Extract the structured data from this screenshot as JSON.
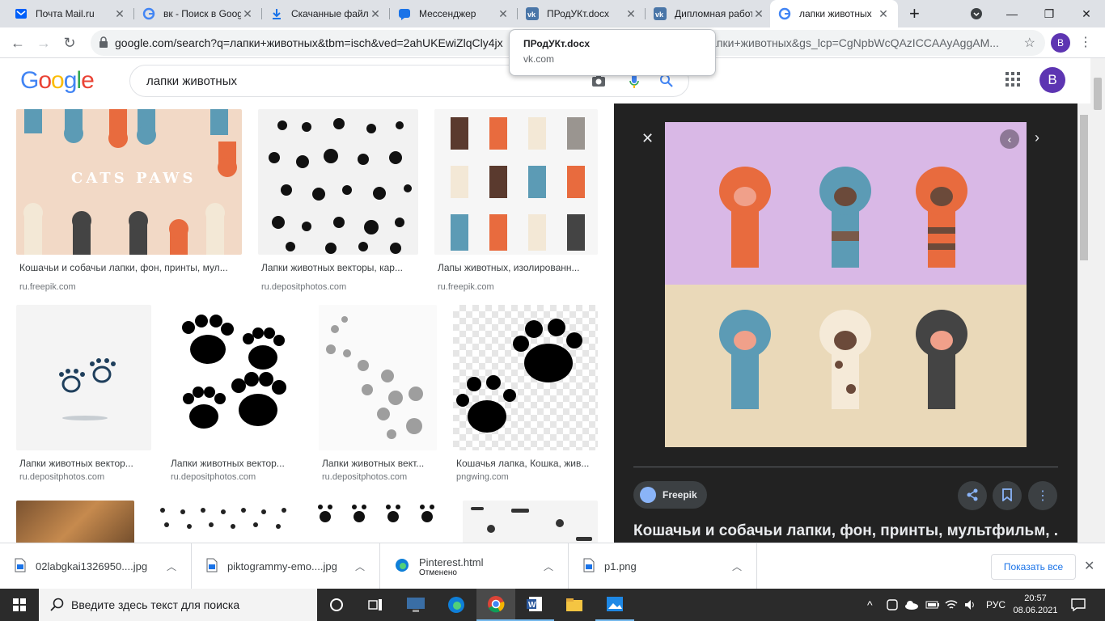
{
  "tabs": [
    {
      "label": "Почта Mail.ru",
      "icon": "mail-icon"
    },
    {
      "label": "вк - Поиск в Google",
      "icon": "google-icon"
    },
    {
      "label": "Скачанные файлы",
      "icon": "download-icon"
    },
    {
      "label": "Мессенджер",
      "icon": "messenger-icon"
    },
    {
      "label": "ПРодУКт.docx",
      "icon": "vk-icon"
    },
    {
      "label": "Дипломная работа",
      "icon": "vk-icon"
    },
    {
      "label": "лапки животных",
      "icon": "google-icon"
    }
  ],
  "toolbar": {
    "url": "google.com/search?q=лапки+животных&tbm=isch&ved=2ahUKEwiZlqCly4jx",
    "url_tail": "лапки+животных&gs_lcp=CgNpbWcQAzICCAAyAggAM...",
    "profile": "B"
  },
  "tooltip": {
    "title": "ПРодУКт.docx",
    "host": "vk.com"
  },
  "google": {
    "logo": "Google",
    "query": "лапки животных",
    "avatar": "B"
  },
  "results": [
    {
      "title": "Кошачьи и собачьи лапки, фон, принты, мул...",
      "source": "ru.freepik.com",
      "overlay": "CATS PAWS"
    },
    {
      "title": "Лапки животных векторы, кар...",
      "source": "ru.depositphotos.com"
    },
    {
      "title": "Лапы животных, изолированн...",
      "source": "ru.freepik.com"
    },
    {
      "title": "Лапки животных вектор...",
      "source": "ru.depositphotos.com"
    },
    {
      "title": "Лапки животных вектор...",
      "source": "ru.depositphotos.com"
    },
    {
      "title": "Лапки животных вект...",
      "source": "ru.depositphotos.com"
    },
    {
      "title": "Кошачья лапка, Кошка, жив...",
      "source": "pngwing.com"
    }
  ],
  "preview": {
    "source_badge": "Freepik",
    "title": "Кошачьи и собачьи лапки, фон, принты, мультфильм, ...",
    "colors": {
      "top": "#d9b8e6",
      "bottom": "#ead9b9"
    }
  },
  "downloads": {
    "items": [
      {
        "name": "02labgkai1326950....jpg",
        "status": ""
      },
      {
        "name": "piktogrammy-emo....jpg",
        "status": ""
      },
      {
        "name": "Pinterest.html",
        "status": "Отменено"
      },
      {
        "name": "p1.png",
        "status": ""
      }
    ],
    "show_all": "Показать все"
  },
  "taskbar": {
    "search_placeholder": "Введите здесь текст для поиска",
    "lang": "РУС",
    "time": "20:57",
    "date": "08.06.2021"
  }
}
